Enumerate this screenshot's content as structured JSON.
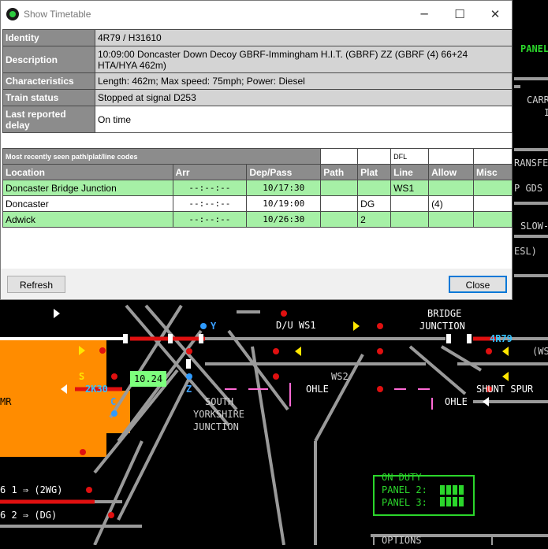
{
  "window": {
    "title": "Show Timetable",
    "controls": {
      "minimize": "─",
      "maximize": "☐",
      "close": "✕"
    }
  },
  "info": [
    {
      "label": "Identity",
      "value": "4R79 / H31610"
    },
    {
      "label": "Description",
      "value": "10:09:00 Doncaster Down Decoy GBRF-Immingham H.I.T. (GBRF) ZZ (GBRF (4) 66+24 HTA/HYA 462m)"
    },
    {
      "label": "Characteristics",
      "value": "Length: 462m; Max speed: 75mph; Power: Diesel"
    },
    {
      "label": "Train status",
      "value": "Stopped at signal D253"
    },
    {
      "label": "Last reported delay",
      "value": "On time"
    }
  ],
  "paths": {
    "caption": "Most recently seen path/plat/line codes",
    "line_code": "DFL",
    "headers": [
      "Location",
      "Arr",
      "Dep/Pass",
      "Path",
      "Plat",
      "Line",
      "Allow",
      "Misc"
    ],
    "rows": [
      {
        "location": "Doncaster Bridge Junction",
        "arr": "--:--:--",
        "dep": "10/17:30",
        "path": "",
        "plat": "",
        "line": "WS1",
        "allow": "",
        "misc": ""
      },
      {
        "location": "Doncaster",
        "arr": "--:--:--",
        "dep": "10/19:00",
        "path": "",
        "plat": "DG",
        "line": "",
        "allow": "(4)",
        "misc": ""
      },
      {
        "location": "Adwick",
        "arr": "--:--:--",
        "dep": "10/26:30",
        "path": "",
        "plat": "2",
        "line": "",
        "allow": "",
        "misc": ""
      }
    ]
  },
  "buttons": {
    "refresh": "Refresh",
    "close": "Close"
  },
  "panel": {
    "right_fragments": [
      "PANEL",
      "CARR",
      "I",
      "RANSFE",
      "P GDS",
      "SLOW-",
      "ESL)"
    ],
    "labels": {
      "du_ws1": "D/U WS1",
      "bridge_junction_1": "BRIDGE",
      "bridge_junction_2": "JUNCTION",
      "berth_4r79": "4R79",
      "ws_right": "(WS",
      "ws2": "WS2",
      "ohle_1": "OHLE",
      "ohle_2": "OHLE",
      "shunt_spur": "SHUNT SPUR",
      "south_1": "SOUTH",
      "south_2": "YORKSHIRE",
      "south_3": "JUNCTION",
      "berth_2k30": "2K30",
      "time_box": "10.24",
      "sig_s": "S",
      "sig_c": "C",
      "sig_y": "Y",
      "sig_z": "Z",
      "mr": "MR",
      "route_1": "6 1 ⇒ (2WG)",
      "route_2": "6 2 ⇒ (DG)",
      "on_duty": "ON DUTY",
      "panel_2": "PANEL 2:",
      "panel_3": "PANEL 3:",
      "options": "OPTIONS"
    },
    "colors": {
      "track": "#9a9a9a",
      "occupied": "#e01010",
      "platform": "#ff8c00",
      "duty": "#2bd62b",
      "ohle": "#ff6ad5"
    }
  }
}
